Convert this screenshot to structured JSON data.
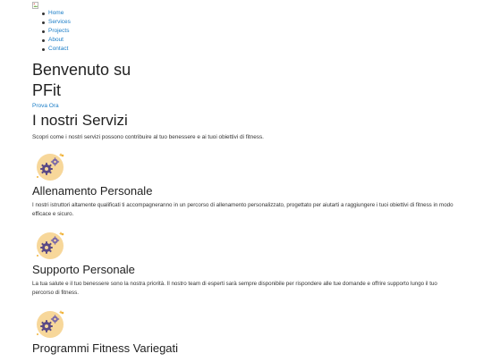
{
  "nav": {
    "items": [
      "Home",
      "Services",
      "Projects",
      "About",
      "Contact"
    ]
  },
  "hero": {
    "title": "Benvenuto su PFit",
    "cta_label": "Prova Ora"
  },
  "services_section": {
    "title": "I nostri Servizi",
    "subtitle": "Scopri come i nostri servizi possono contribuire al tuo benessere e ai tuoi obiettivi di fitness."
  },
  "services": [
    {
      "title": "Allenamento Personale",
      "description": "I nostri istruttori altamente qualificati ti accompagneranno in un percorso di allenamento personalizzato, progettato per aiutarti a raggiungere i tuoi obiettivi di fitness in modo efficace e sicuro.",
      "icon": "gears-icon"
    },
    {
      "title": "Supporto Personale",
      "description": "La tua salute e il tuo benessere sono la nostra priorità. Il nostro team di esperti sarà sempre disponibile per rispondere alle tue domande e offrire supporto lungo il tuo percorso di fitness.",
      "icon": "gears-icon"
    },
    {
      "title": "Programmi Fitness Variegati",
      "description": "",
      "icon": "gears-icon"
    }
  ],
  "colors": {
    "link": "#1a7dc7",
    "icon_bg": "#f7d79a",
    "gear": "#5b4a86",
    "sparkle": "#f0b43c"
  }
}
